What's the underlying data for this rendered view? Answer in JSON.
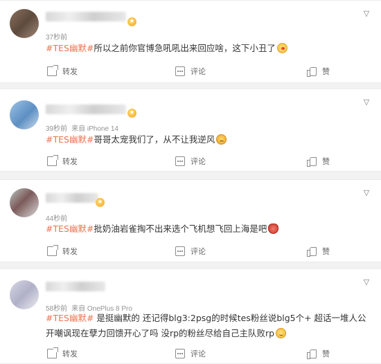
{
  "hashtag": "#TES幽默#",
  "actions": {
    "repost": "转发",
    "comment": "评论",
    "like": "赞"
  },
  "comments": [
    {
      "time": "37秒前",
      "source": "",
      "text": "所以之前你官博急吼吼出来回应啥，这下小丑了",
      "emoji": "clown-emoji"
    },
    {
      "time": "39秒前",
      "source": "来自 iPhone 14",
      "text": "哥哥太宠我们了，从不让我逆风",
      "emoji": "sad-emoji"
    },
    {
      "time": "44秒前",
      "source": "",
      "text": "批奶油岩雀掏不出来选个飞机想飞回上海是吧",
      "emoji": "angry-emoji"
    },
    {
      "time": "58秒前",
      "source": "来自 OnePlus 8 Pro",
      "text": " 是挺幽默的 还记得blg3:2psg的时候tes粉丝说blg5个+ 超话一堆人公开嘲讽现在孽力回馈开心了吗 没rp的粉丝尽给自己主队败rp",
      "emoji": "smile-emoji"
    }
  ],
  "colors": {
    "hashtag": "#eb7350",
    "meta": "#939393",
    "text": "#333333",
    "background": "#f2f2f2"
  }
}
